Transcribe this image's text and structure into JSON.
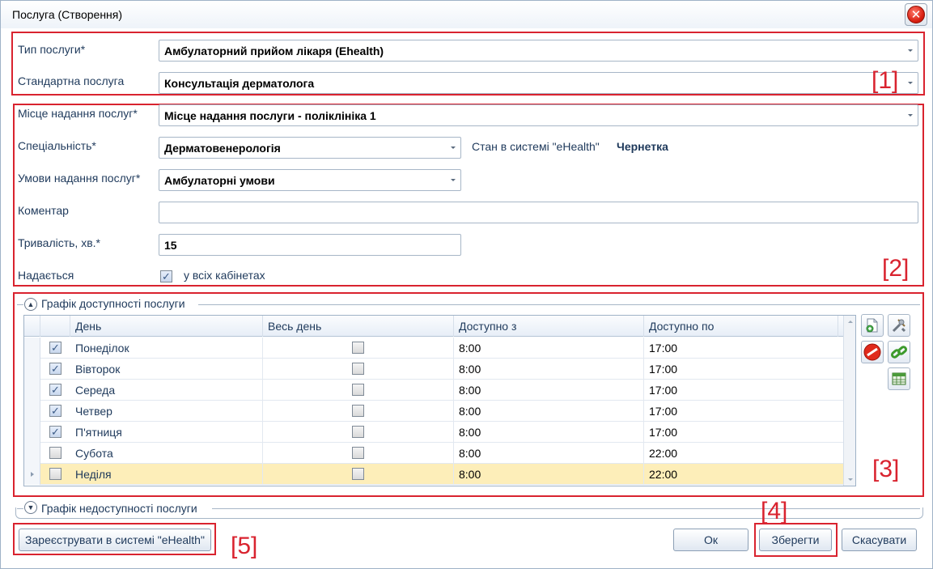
{
  "window": {
    "title": "Послуга (Створення)"
  },
  "form": {
    "service_type_label": "Тип послуги*",
    "service_type_value": "Амбулаторний прийом лікаря (Ehealth)",
    "standard_service_label": "Стандартна послуга",
    "standard_service_value": "Консультація дерматолога",
    "place_label": "Місце надання послуг*",
    "place_value": "Місце надання послуги - поліклініка 1",
    "specialty_label": "Спеціальність*",
    "specialty_value": "Дерматовенерологія",
    "ehealth_status_label": "Стан в системі \"eHealth\"",
    "ehealth_status_value": "Чернетка",
    "conditions_label": "Умови надання послуг*",
    "conditions_value": "Амбулаторні умови",
    "comment_label": "Коментар",
    "comment_value": "",
    "duration_label": "Тривалість, хв.*",
    "duration_value": "15",
    "provided_label": "Надається",
    "all_rooms_label": "у всіх кабінетах",
    "all_rooms_checked": true
  },
  "availability": {
    "header": "Графік доступності послуги",
    "columns": [
      "День",
      "Весь день",
      "Доступно з",
      "Доступно по"
    ],
    "rows": [
      {
        "checked": true,
        "day": "Понеділок",
        "all_day": false,
        "from": "8:00",
        "to": "17:00"
      },
      {
        "checked": true,
        "day": "Вівторок",
        "all_day": false,
        "from": "8:00",
        "to": "17:00"
      },
      {
        "checked": true,
        "day": "Середа",
        "all_day": false,
        "from": "8:00",
        "to": "17:00"
      },
      {
        "checked": true,
        "day": "Четвер",
        "all_day": false,
        "from": "8:00",
        "to": "17:00"
      },
      {
        "checked": true,
        "day": "П'ятниця",
        "all_day": false,
        "from": "8:00",
        "to": "17:00"
      },
      {
        "checked": false,
        "day": "Субота",
        "all_day": false,
        "from": "8:00",
        "to": "22:00"
      },
      {
        "checked": false,
        "day": "Неділя",
        "all_day": false,
        "from": "8:00",
        "to": "22:00"
      }
    ],
    "tools": [
      "new-document-icon",
      "tools-icon",
      "delete-icon",
      "link-icon",
      "table-icon"
    ]
  },
  "unavailability": {
    "header": "Графік недоступності послуги"
  },
  "buttons": {
    "register": "Зареєструвати в системі \"eHealth\"",
    "ok": "Ок",
    "save": "Зберегти",
    "cancel": "Скасувати"
  },
  "annotations": {
    "a1": "[1]",
    "a2": "[2]",
    "a3": "[3]",
    "a4": "[4]",
    "a5": "[5]"
  },
  "colors": {
    "annotation_red": "#d9232f",
    "label_blue": "#1e395b",
    "selected_row": "#fdeeb9"
  }
}
